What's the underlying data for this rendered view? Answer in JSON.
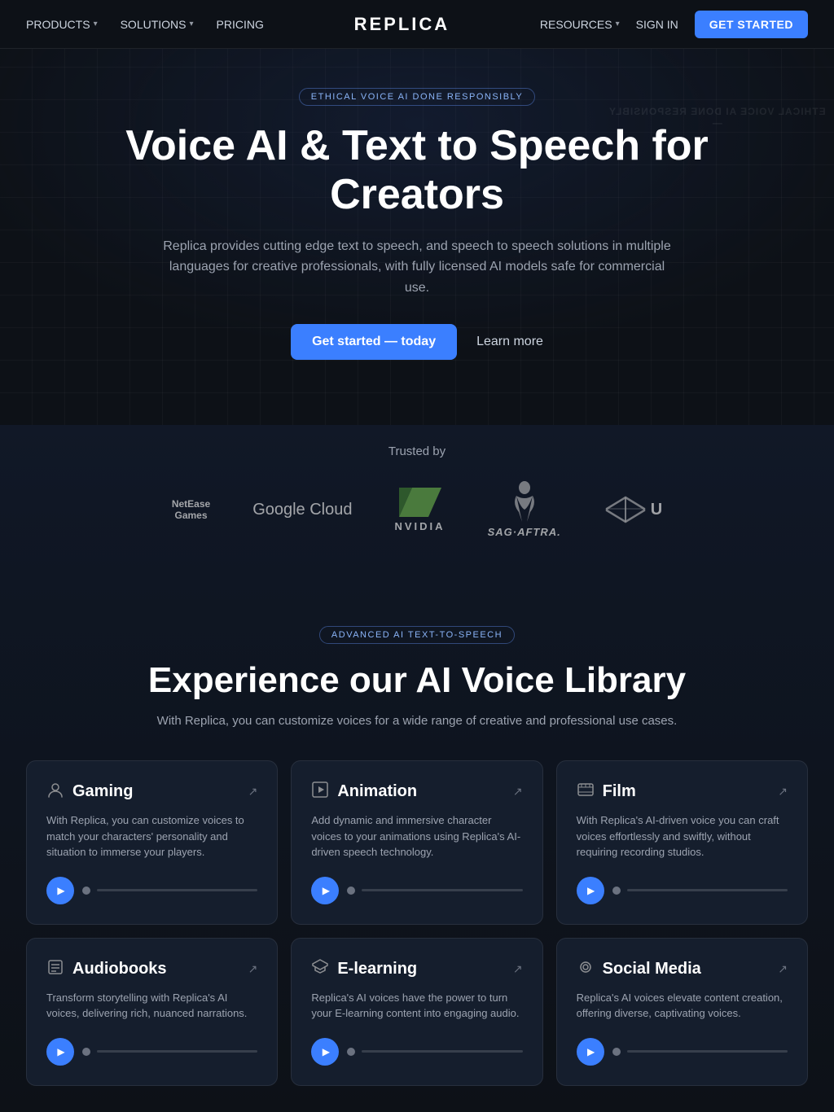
{
  "nav": {
    "products_label": "PRODUCTS",
    "solutions_label": "SOLUTIONS",
    "pricing_label": "PRICING",
    "logo": "REPLICA",
    "resources_label": "RESOURCES",
    "signin_label": "SIGN IN",
    "get_started_label": "GET STARTED"
  },
  "hero": {
    "ethical_badge": "ETHICAL VOICE AI DONE RESPONSIBLY",
    "title": "Voice AI & Text to Speech for Creators",
    "subtitle": "Replica provides cutting edge text to speech, and speech to speech solutions in multiple languages for creative professionals, with fully licensed AI models safe for commercial use.",
    "cta_label": "Get started — today",
    "learn_label": "Learn more",
    "bg_text_1": "ETHICAL VOICE AI DONE RESPONSIBLY",
    "bg_text_2": "—"
  },
  "trusted": {
    "label": "Trusted by",
    "logos": [
      {
        "name": "NetEase Games",
        "type": "netease"
      },
      {
        "name": "Google Cloud",
        "type": "google"
      },
      {
        "name": "NVIDIA",
        "type": "nvidia"
      },
      {
        "name": "SAG-AFTRA",
        "type": "sag"
      },
      {
        "name": "Unity",
        "type": "unity"
      }
    ]
  },
  "voice_section": {
    "advanced_badge": "ADVANCED AI TEXT-TO-SPEECH",
    "title": "Experience our AI Voice Library",
    "subtitle": "With Replica, you can customize voices for a wide range of creative and professional use cases.",
    "cards": [
      {
        "id": "gaming",
        "icon": "👤",
        "title": "Gaming",
        "description": "With Replica, you can customize voices to match your characters' personality and situation to immerse your players."
      },
      {
        "id": "animation",
        "icon": "◈",
        "title": "Animation",
        "description": "Add dynamic and immersive character voices to your animations using Replica's AI-driven speech technology."
      },
      {
        "id": "film",
        "icon": "🎞",
        "title": "Film",
        "description": "With Replica's AI-driven voice you can craft voices effortlessly and swiftly, without requiring recording studios."
      },
      {
        "id": "audiobooks",
        "icon": "📖",
        "title": "Audiobooks",
        "description": "Transform storytelling with Replica's AI voices, delivering rich, nuanced narrations."
      },
      {
        "id": "elearning",
        "icon": "🎓",
        "title": "E-learning",
        "description": "Replica's AI voices have the power to turn your E-learning content into engaging audio."
      },
      {
        "id": "socialmedia",
        "icon": "🎙",
        "title": "Social Media",
        "description": "Replica's AI voices elevate content creation, offering diverse, captivating voices."
      }
    ]
  }
}
